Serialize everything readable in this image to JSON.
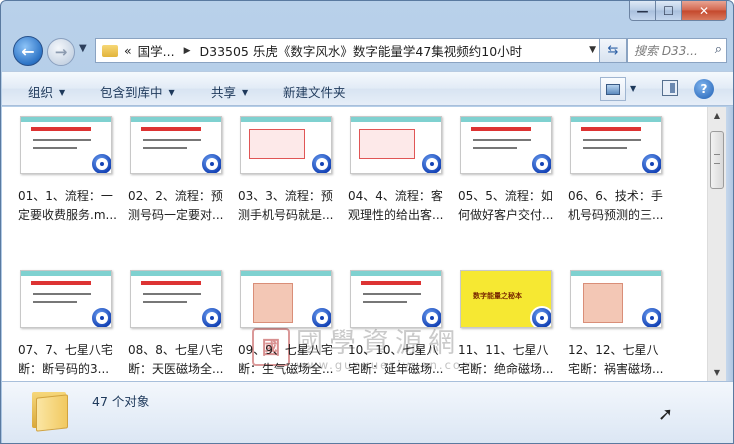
{
  "window": {
    "minimize_glyph": "—",
    "maximize_glyph": "☐",
    "close_glyph": "✕"
  },
  "nav": {
    "back_glyph": "←",
    "forward_glyph": "→",
    "address": {
      "overflow": "«",
      "crumbs": [
        "国学...",
        "D33505 乐虎《数字风水》数字能量学47集视频约10小时"
      ]
    },
    "search_placeholder": "搜索 D33..."
  },
  "toolbar": {
    "organize": "组织",
    "include_in_library": "包含到库中",
    "share": "共享",
    "new_folder": "新建文件夹"
  },
  "files": [
    {
      "label": "01、1、流程：一定要收费服务.m...",
      "thumb": "red-title"
    },
    {
      "label": "02、2、流程：预测号码一定要对...",
      "thumb": "red-title"
    },
    {
      "label": "03、3、流程：预测手机号码就是...",
      "thumb": "red-box"
    },
    {
      "label": "04、4、流程：客观理性的给出客...",
      "thumb": "red-box"
    },
    {
      "label": "05、5、流程：如何做好客户交付...",
      "thumb": "red-title"
    },
    {
      "label": "06、6、技术：手机号码预测的三...",
      "thumb": "red-title"
    },
    {
      "label": "07、7、七星八宅断：断号码的3...",
      "thumb": "red-title"
    },
    {
      "label": "08、8、七星八宅断：天医磁场全...",
      "thumb": "red-title"
    },
    {
      "label": "09、9、七星八宅断：生气磁场全...",
      "thumb": "hand"
    },
    {
      "label": "10、10、七星八宅断：延年磁场...",
      "thumb": "red-title"
    },
    {
      "label": "11、11、七星八宅断：绝命磁场...",
      "thumb": "yellow"
    },
    {
      "label": "12、12、七星八宅断：祸害磁场...",
      "thumb": "hand"
    }
  ],
  "thumb_texts": {
    "yellow": "数字能量之秘本"
  },
  "watermark": {
    "seal": "國",
    "big": "國學資源網",
    "url": "www.guoxueziyuan.com"
  },
  "status": {
    "item_count": "47 个对象"
  }
}
